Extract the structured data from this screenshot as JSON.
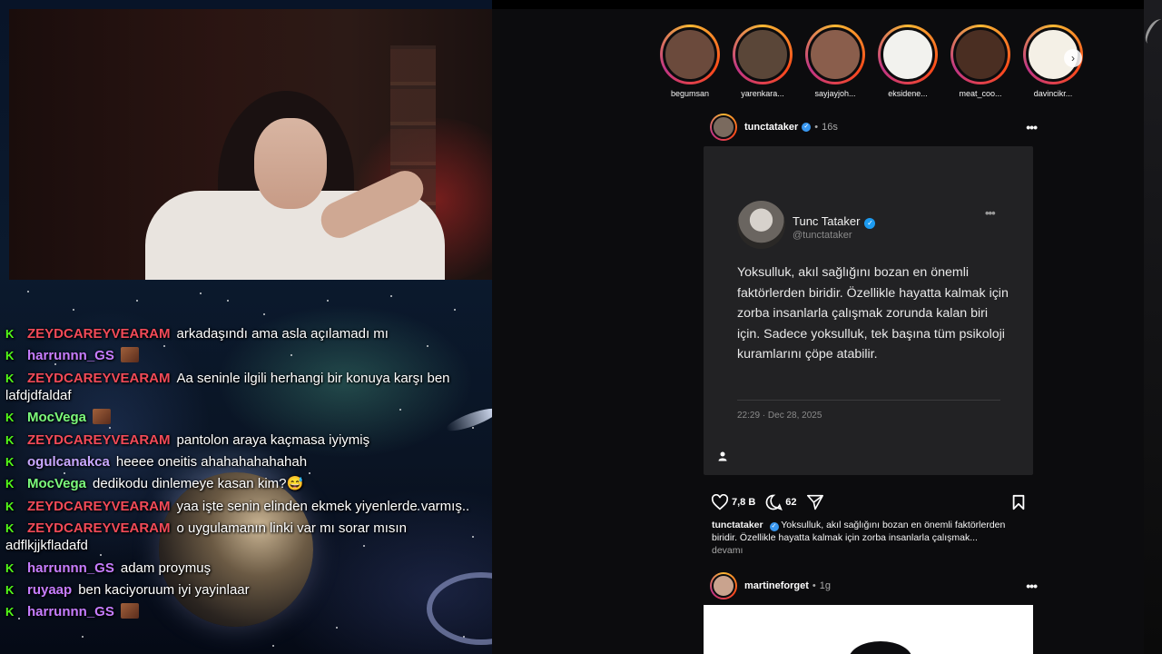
{
  "chat": {
    "messages": [
      {
        "user": "ZEYDCAREYVEARAM",
        "color": "#f24a58",
        "text": "arkadaşındı ama asla açılamadı mı",
        "emote": false
      },
      {
        "user": "harrunnn_GS",
        "color": "#c77dff",
        "text": "",
        "emote": true
      },
      {
        "user": "ZEYDCAREYVEARAM",
        "color": "#f24a58",
        "text": "Aa seninle ilgili herhangi bir konuya karşı ben lafdjdfaldaf",
        "emote": false
      },
      {
        "user": "MocVega",
        "color": "#7CFC7C",
        "text": "",
        "emote": true
      },
      {
        "user": "ZEYDCAREYVEARAM",
        "color": "#f24a58",
        "text": "pantolon araya kaçmasa iyiymiş",
        "emote": false
      },
      {
        "user": "ogulcanakca",
        "color": "#c9a8ff",
        "text": "heeee oneitis ahahahahahahah",
        "emote": false
      },
      {
        "user": "MocVega",
        "color": "#7CFC7C",
        "text": "dedikodu dinlemeye kasan kim?😅",
        "emote": false
      },
      {
        "user": "ZEYDCAREYVEARAM",
        "color": "#f24a58",
        "text": "yaa işte senin elinden ekmek yiyenlerde varmış..",
        "emote": false
      },
      {
        "user": "ZEYDCAREYVEARAM",
        "color": "#f24a58",
        "text": "o uygulamanın linki var mı sorar mısın adflkjjkfladafd",
        "emote": false
      },
      {
        "user": "harrunnn_GS",
        "color": "#c77dff",
        "text": "adam proymuş",
        "emote": false
      },
      {
        "user": "ruyaap",
        "color": "#c77dff",
        "text": "ben kaciyoruum iyi yayinlaar",
        "emote": false
      },
      {
        "user": "harrunnn_GS",
        "color": "#c77dff",
        "text": "",
        "emote": true
      }
    ]
  },
  "stories": [
    {
      "name": "begumsan",
      "color": "#6b4a3c"
    },
    {
      "name": "yarenkara...",
      "color": "#5a4638"
    },
    {
      "name": "sayjayjoh...",
      "color": "#8a5e4c"
    },
    {
      "name": "eksidene...",
      "color": "#f2f2ee"
    },
    {
      "name": "meat_coo...",
      "color": "#4a2e22"
    },
    {
      "name": "davincikr...",
      "color": "#f4f0e6"
    }
  ],
  "post": {
    "username": "tunctataker",
    "time": "16s",
    "tweet": {
      "name": "Tunc Tataker",
      "handle": "@tunctataker",
      "text": "Yoksulluk, akıl sağlığını bozan en önemli faktörlerden biridir. Özellikle hayatta kalmak için zorba insanlarla çalışmak zorunda kalan biri için. Sadece yoksulluk, tek başına tüm psikoloji kuramlarını çöpe atabilir.",
      "date": "22:29 · Dec 28, 2025"
    },
    "likes": "7,8 B",
    "comments": "62",
    "caption_user": "tunctataker",
    "caption_text": "Yoksulluk, akıl sağlığını bozan en önemli faktörlerden biridir. Özellikle hayatta kalmak için zorba insanlarla çalışmak...",
    "more_label": "devamı"
  },
  "next_post": {
    "username": "martineforget",
    "time": "1g"
  },
  "colors": {
    "kick_green": "#53fc18",
    "verified_blue": "#3897f0"
  }
}
